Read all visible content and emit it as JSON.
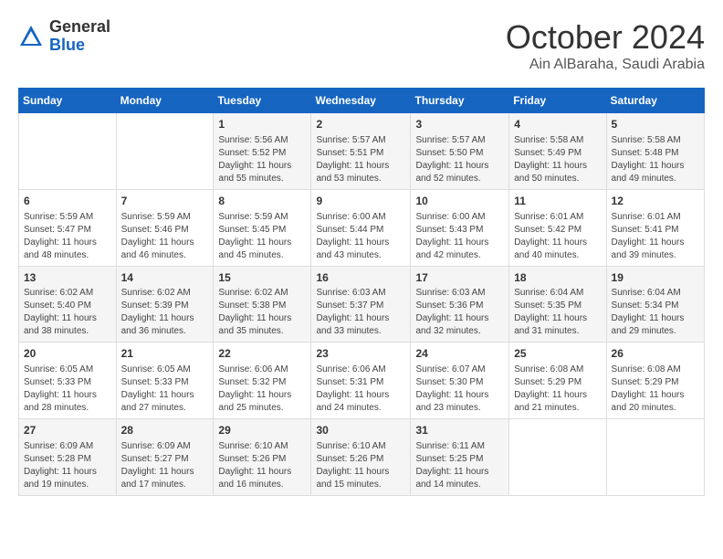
{
  "header": {
    "logo_general": "General",
    "logo_blue": "Blue",
    "month": "October 2024",
    "location": "Ain AlBaraha, Saudi Arabia"
  },
  "weekdays": [
    "Sunday",
    "Monday",
    "Tuesday",
    "Wednesday",
    "Thursday",
    "Friday",
    "Saturday"
  ],
  "weeks": [
    [
      null,
      null,
      {
        "day": 1,
        "sunrise": "5:56 AM",
        "sunset": "5:52 PM",
        "daylight": "11 hours and 55 minutes."
      },
      {
        "day": 2,
        "sunrise": "5:57 AM",
        "sunset": "5:51 PM",
        "daylight": "11 hours and 53 minutes."
      },
      {
        "day": 3,
        "sunrise": "5:57 AM",
        "sunset": "5:50 PM",
        "daylight": "11 hours and 52 minutes."
      },
      {
        "day": 4,
        "sunrise": "5:58 AM",
        "sunset": "5:49 PM",
        "daylight": "11 hours and 50 minutes."
      },
      {
        "day": 5,
        "sunrise": "5:58 AM",
        "sunset": "5:48 PM",
        "daylight": "11 hours and 49 minutes."
      }
    ],
    [
      {
        "day": 6,
        "sunrise": "5:59 AM",
        "sunset": "5:47 PM",
        "daylight": "11 hours and 48 minutes."
      },
      {
        "day": 7,
        "sunrise": "5:59 AM",
        "sunset": "5:46 PM",
        "daylight": "11 hours and 46 minutes."
      },
      {
        "day": 8,
        "sunrise": "5:59 AM",
        "sunset": "5:45 PM",
        "daylight": "11 hours and 45 minutes."
      },
      {
        "day": 9,
        "sunrise": "6:00 AM",
        "sunset": "5:44 PM",
        "daylight": "11 hours and 43 minutes."
      },
      {
        "day": 10,
        "sunrise": "6:00 AM",
        "sunset": "5:43 PM",
        "daylight": "11 hours and 42 minutes."
      },
      {
        "day": 11,
        "sunrise": "6:01 AM",
        "sunset": "5:42 PM",
        "daylight": "11 hours and 40 minutes."
      },
      {
        "day": 12,
        "sunrise": "6:01 AM",
        "sunset": "5:41 PM",
        "daylight": "11 hours and 39 minutes."
      }
    ],
    [
      {
        "day": 13,
        "sunrise": "6:02 AM",
        "sunset": "5:40 PM",
        "daylight": "11 hours and 38 minutes."
      },
      {
        "day": 14,
        "sunrise": "6:02 AM",
        "sunset": "5:39 PM",
        "daylight": "11 hours and 36 minutes."
      },
      {
        "day": 15,
        "sunrise": "6:02 AM",
        "sunset": "5:38 PM",
        "daylight": "11 hours and 35 minutes."
      },
      {
        "day": 16,
        "sunrise": "6:03 AM",
        "sunset": "5:37 PM",
        "daylight": "11 hours and 33 minutes."
      },
      {
        "day": 17,
        "sunrise": "6:03 AM",
        "sunset": "5:36 PM",
        "daylight": "11 hours and 32 minutes."
      },
      {
        "day": 18,
        "sunrise": "6:04 AM",
        "sunset": "5:35 PM",
        "daylight": "11 hours and 31 minutes."
      },
      {
        "day": 19,
        "sunrise": "6:04 AM",
        "sunset": "5:34 PM",
        "daylight": "11 hours and 29 minutes."
      }
    ],
    [
      {
        "day": 20,
        "sunrise": "6:05 AM",
        "sunset": "5:33 PM",
        "daylight": "11 hours and 28 minutes."
      },
      {
        "day": 21,
        "sunrise": "6:05 AM",
        "sunset": "5:33 PM",
        "daylight": "11 hours and 27 minutes."
      },
      {
        "day": 22,
        "sunrise": "6:06 AM",
        "sunset": "5:32 PM",
        "daylight": "11 hours and 25 minutes."
      },
      {
        "day": 23,
        "sunrise": "6:06 AM",
        "sunset": "5:31 PM",
        "daylight": "11 hours and 24 minutes."
      },
      {
        "day": 24,
        "sunrise": "6:07 AM",
        "sunset": "5:30 PM",
        "daylight": "11 hours and 23 minutes."
      },
      {
        "day": 25,
        "sunrise": "6:08 AM",
        "sunset": "5:29 PM",
        "daylight": "11 hours and 21 minutes."
      },
      {
        "day": 26,
        "sunrise": "6:08 AM",
        "sunset": "5:29 PM",
        "daylight": "11 hours and 20 minutes."
      }
    ],
    [
      {
        "day": 27,
        "sunrise": "6:09 AM",
        "sunset": "5:28 PM",
        "daylight": "11 hours and 19 minutes."
      },
      {
        "day": 28,
        "sunrise": "6:09 AM",
        "sunset": "5:27 PM",
        "daylight": "11 hours and 17 minutes."
      },
      {
        "day": 29,
        "sunrise": "6:10 AM",
        "sunset": "5:26 PM",
        "daylight": "11 hours and 16 minutes."
      },
      {
        "day": 30,
        "sunrise": "6:10 AM",
        "sunset": "5:26 PM",
        "daylight": "11 hours and 15 minutes."
      },
      {
        "day": 31,
        "sunrise": "6:11 AM",
        "sunset": "5:25 PM",
        "daylight": "11 hours and 14 minutes."
      },
      null,
      null
    ]
  ]
}
